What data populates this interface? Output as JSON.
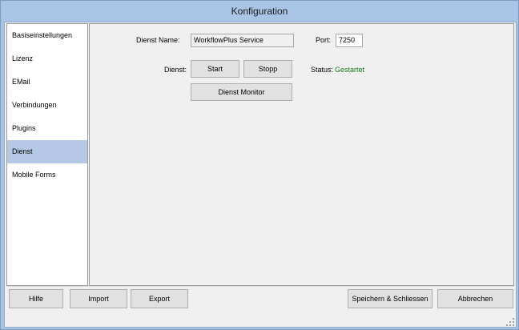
{
  "window": {
    "title": "Konfiguration"
  },
  "sidebar": {
    "selected_index": 5,
    "items": [
      {
        "label": "Basiseinstellungen"
      },
      {
        "label": "Lizenz"
      },
      {
        "label": "EMail"
      },
      {
        "label": "Verbindungen"
      },
      {
        "label": "Plugins"
      },
      {
        "label": "Dienst"
      },
      {
        "label": "Mobile Forms"
      }
    ]
  },
  "service": {
    "name_label": "Dienst Name:",
    "name_value": "WorkflowPlus Service",
    "port_label": "Port:",
    "port_value": "7250",
    "service_label": "Dienst:",
    "start_label": "Start",
    "stop_label": "Stopp",
    "status_label": "Status:",
    "status_value": "Gestartet",
    "monitor_label": "Dienst Monitor"
  },
  "footer": {
    "help_label": "Hilfe",
    "import_label": "Import",
    "export_label": "Export",
    "save_close_label": "Speichern & Schliessen",
    "cancel_label": "Abbrechen"
  },
  "colors": {
    "frame": "#a9c4e4",
    "selected_item": "#b5c9e6",
    "status_ok": "#1a7d1a"
  }
}
